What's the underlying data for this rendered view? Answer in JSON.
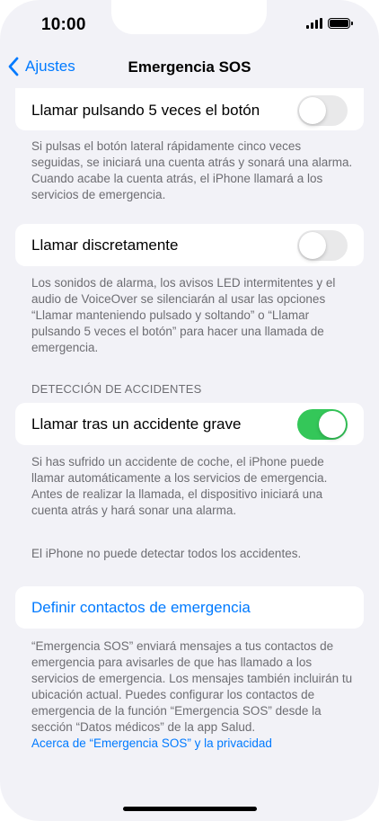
{
  "status_bar": {
    "time": "10:00",
    "battery_level": 1.0
  },
  "nav": {
    "back_label": "Ajustes",
    "title": "Emergencia SOS"
  },
  "settings": {
    "five_press": {
      "label": "Llamar pulsando 5 veces el botón",
      "enabled": false,
      "footer": "Si pulsas el botón lateral rápidamente cinco veces seguidas, se iniciará una cuenta atrás y sonará una alarma. Cuando acabe la cuenta atrás, el iPhone llamará a los servicios de emergencia."
    },
    "silent_call": {
      "label": "Llamar discretamente",
      "enabled": false,
      "footer": "Los sonidos de alarma, los avisos LED intermitentes y el audio de VoiceOver se silenciarán al usar las opciones “Llamar manteniendo pulsado y soltando” o “Llamar pulsando 5 veces el botón” para hacer una llamada de emergencia."
    },
    "crash_detection": {
      "header": "DETECCIÓN DE ACCIDENTES",
      "label": "Llamar tras un accidente grave",
      "enabled": true,
      "footer": "Si has sufrido un accidente de coche, el iPhone puede llamar automáticamente a los servicios de emergencia. Antes de realizar la llamada, el dispositivo iniciará una cuenta atrás y hará sonar una alarma.",
      "footer_note": "El iPhone no puede detectar todos los accidentes."
    },
    "contacts": {
      "label": "Definir contactos de emergencia",
      "footer": "“Emergencia SOS” enviará mensajes a tus contactos de emergencia para avisarles de que has llamado a los servicios de emergencia. Los mensajes también incluirán tu ubicación actual. Puedes configurar los contactos de emergencia de la función “Emergencia SOS” desde la sección “Datos médicos” de la app Salud.",
      "privacy_link": "Acerca de “Emergencia SOS” y la privacidad"
    }
  },
  "colors": {
    "accent": "#007aff",
    "toggle_on": "#34c759",
    "toggle_off": "#e9e9ea",
    "background": "#f2f2f7",
    "secondary_text": "#6d6d72"
  }
}
